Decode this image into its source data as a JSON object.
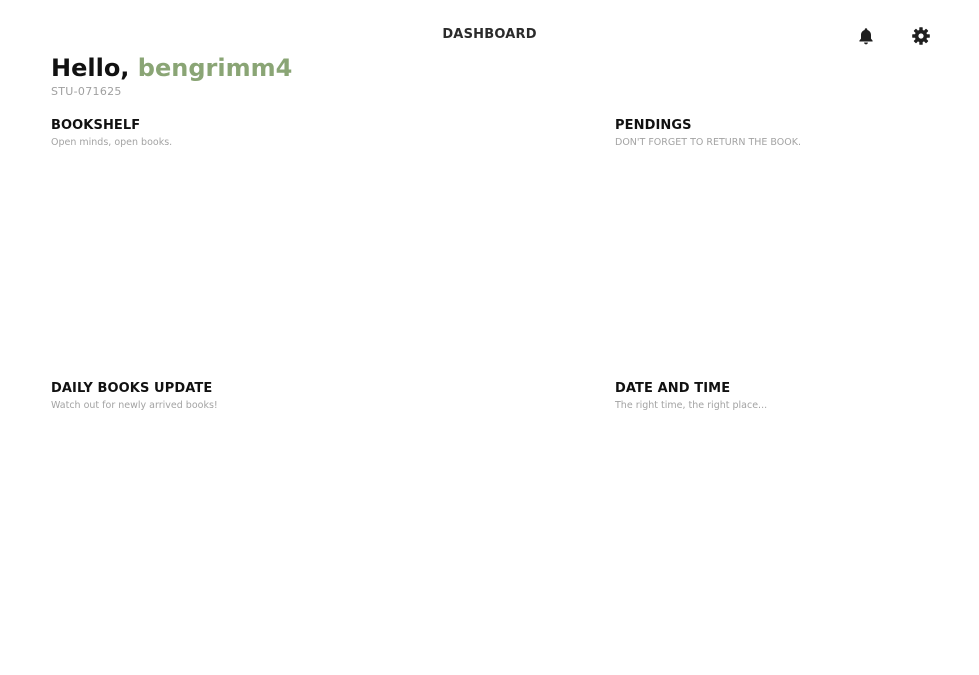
{
  "header": {
    "title": "DASHBOARD",
    "notifications_icon": "bell-icon",
    "settings_icon": "gear-icon"
  },
  "greeting": {
    "prefix": "Hello, ",
    "username": "bengrimm4",
    "student_id": "STU-071625",
    "username_color": "#8aa575"
  },
  "sections": {
    "bookshelf": {
      "title": "BOOKSHELF",
      "subtitle": "Open minds, open books."
    },
    "pendings": {
      "title": "PENDINGS",
      "subtitle": "DON'T FORGET TO RETURN THE BOOK."
    },
    "daily_books_update": {
      "title": "DAILY BOOKS UPDATE",
      "subtitle": "Watch out for newly arrived books!"
    },
    "date_and_time": {
      "title": "DATE AND TIME",
      "subtitle": "The right time, the right place..."
    }
  }
}
